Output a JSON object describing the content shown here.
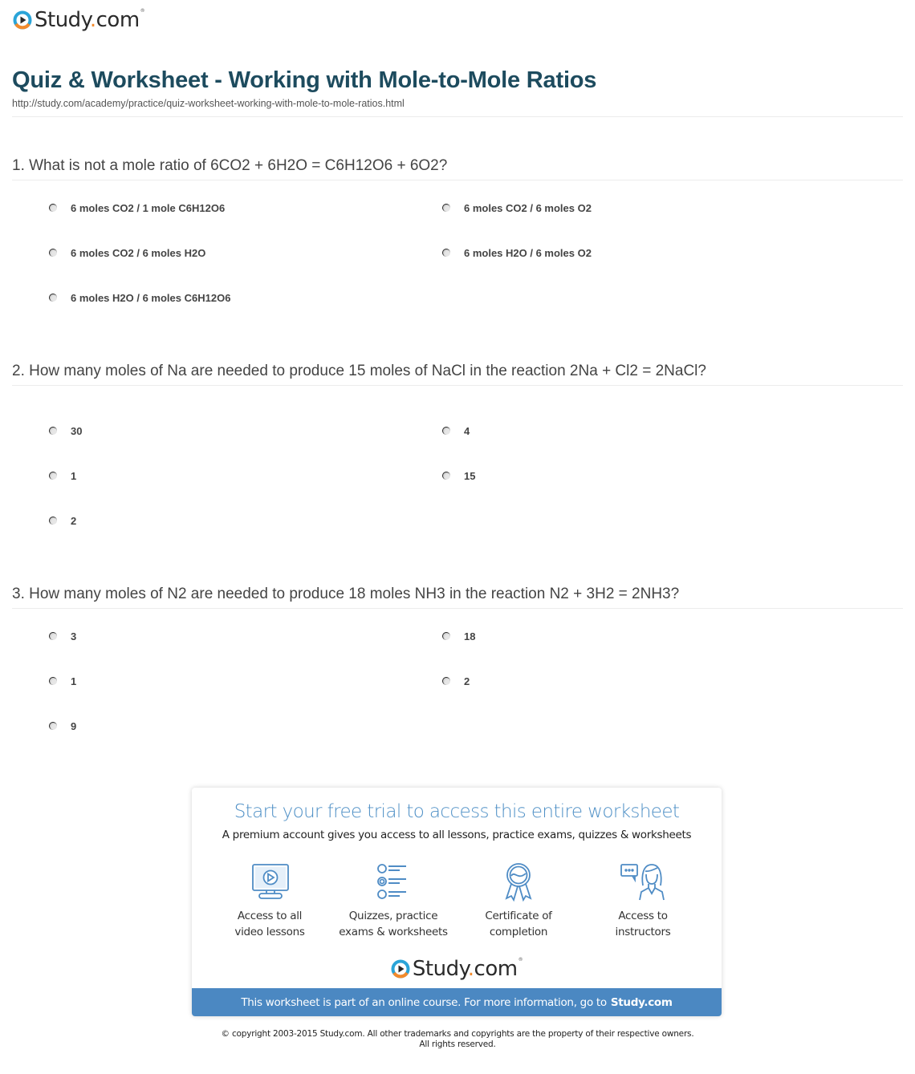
{
  "header": {
    "brand_name": "Study",
    "brand_dot": ".",
    "brand_tld": "com",
    "brand_tm": "®",
    "title": "Quiz & Worksheet - Working with Mole-to-Mole Ratios",
    "url": "http://study.com/academy/practice/quiz-worksheet-working-with-mole-to-mole-ratios.html"
  },
  "questions": [
    {
      "text": "1. What is not a mole ratio of 6CO2 + 6H2O = C6H12O6 + 6O2?",
      "options": [
        "6 moles CO2 / 1 mole C6H12O6",
        "6 moles CO2 / 6 moles O2",
        "6 moles CO2 / 6 moles H2O",
        "6 moles H2O / 6 moles O2",
        "6 moles H2O / 6 moles C6H12O6"
      ]
    },
    {
      "text": "2. How many moles of Na are needed to produce 15 moles of NaCl in the reaction 2Na + Cl2 = 2NaCl?",
      "options": [
        "30",
        "4",
        "1",
        "15",
        "2"
      ]
    },
    {
      "text": "3. How many moles of N2 are needed to produce 18 moles NH3 in the reaction N2 + 3H2 = 2NH3?",
      "options": [
        "3",
        "18",
        "1",
        "2",
        "9"
      ]
    }
  ],
  "promo": {
    "title": "Start your free trial to access this entire worksheet",
    "subtitle": "A premium account gives you access to all lessons, practice exams, quizzes & worksheets",
    "features": [
      {
        "icon": "video-monitor-icon",
        "line1": "Access to all",
        "line2": "video lessons"
      },
      {
        "icon": "quiz-list-icon",
        "line1": "Quizzes, practice",
        "line2": "exams & worksheets"
      },
      {
        "icon": "certificate-ribbon-icon",
        "line1": "Certificate of",
        "line2": "completion"
      },
      {
        "icon": "instructor-chat-icon",
        "line1": "Access to",
        "line2": "instructors"
      }
    ],
    "bar_text": "This worksheet is part of an online course. For more information, go to",
    "bar_link": "Study.com"
  },
  "footer": {
    "copyright_line1": "© copyright 2003-2015 Study.com. All other trademarks and copyrights are the property of their respective owners.",
    "copyright_line2": "All rights reserved."
  },
  "colors": {
    "title": "#1d4b5e",
    "accent_blue": "#4b88c2",
    "brand_orange": "#f38a2b",
    "brand_ring": "#2aa4d8"
  }
}
